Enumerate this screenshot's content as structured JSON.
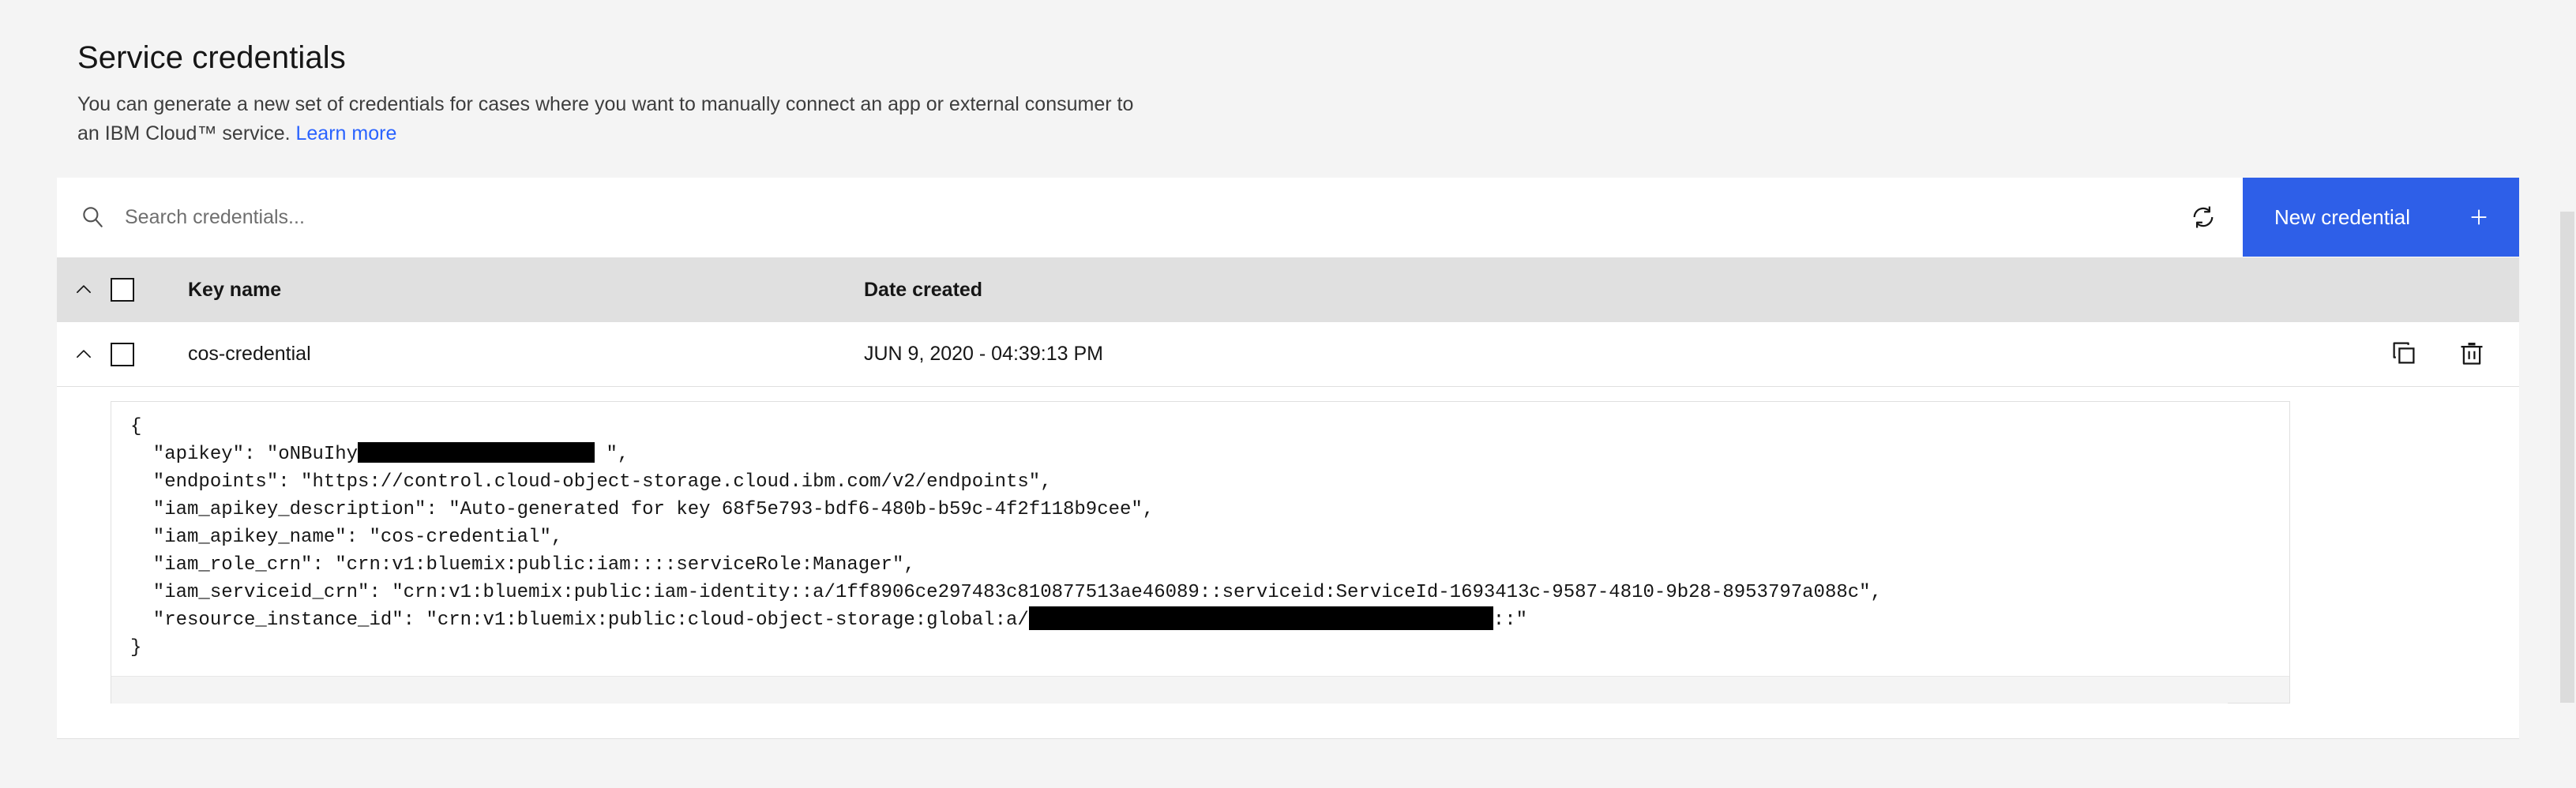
{
  "header": {
    "title": "Service credentials",
    "description_line1": "You can generate a new set of credentials for cases where you want to manually connect an app or external consumer to",
    "description_line2": "an IBM Cloud™ service.",
    "learn_more": "Learn more"
  },
  "toolbar": {
    "search_placeholder": "Search credentials...",
    "search_value": "",
    "search_icon": "search-icon",
    "refresh_icon": "refresh-icon",
    "new_credential_label": "New credential",
    "new_credential_icon": "plus-icon",
    "accent_color": "#2e5fe8"
  },
  "table": {
    "columns": [
      "Key name",
      "Date created"
    ],
    "header_caret_icon": "chevron-up-icon",
    "header_checkbox_checked": false,
    "rows": [
      {
        "caret_icon": "chevron-up-icon",
        "checked": false,
        "key_name": "cos-credential",
        "date_created": "JUN 9, 2020 - 04:39:13 PM",
        "copy_icon": "copy-icon",
        "delete_icon": "trash-icon"
      }
    ]
  },
  "credential_json": {
    "lines": [
      {
        "text": "{"
      },
      {
        "prefix": "  \"apikey\": \"oNBuIhy",
        "redaction": "r1",
        "suffix": " \","
      },
      {
        "text": "  \"endpoints\": \"https://control.cloud-object-storage.cloud.ibm.com/v2/endpoints\","
      },
      {
        "text": "  \"iam_apikey_description\": \"Auto-generated for key 68f5e793-bdf6-480b-b59c-4f2f118b9cee\","
      },
      {
        "text": "  \"iam_apikey_name\": \"cos-credential\","
      },
      {
        "text": "  \"iam_role_crn\": \"crn:v1:bluemix:public:iam::::serviceRole:Manager\","
      },
      {
        "text": "  \"iam_serviceid_crn\": \"crn:v1:bluemix:public:iam-identity::a/1ff8906ce297483c810877513ae46089::serviceid:ServiceId-1693413c-9587-4810-9b28-8953797a088c\","
      },
      {
        "prefix": "  \"resource_instance_id\": \"crn:v1:bluemix:public:cloud-object-storage:global:a/",
        "redaction": "r2",
        "suffix": "::\""
      },
      {
        "text": "}"
      }
    ]
  }
}
